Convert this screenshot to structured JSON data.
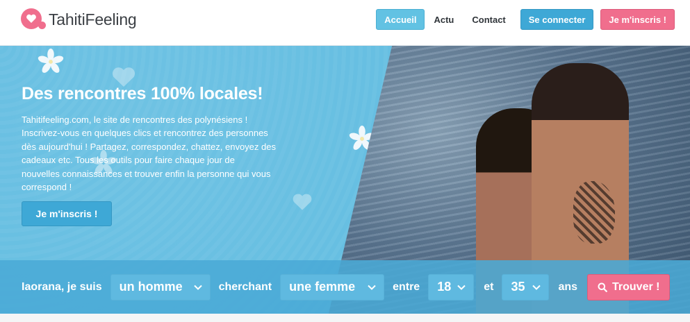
{
  "brand": {
    "name": "TahitiFeeling",
    "colors": {
      "pink": "#f06e8d",
      "blue": "#3ea8d6",
      "light_blue": "#62c2e3",
      "hero_bg": "#67bfe2"
    }
  },
  "nav": {
    "items": [
      {
        "label": "Accueil",
        "style": "active"
      },
      {
        "label": "Actu",
        "style": "link"
      },
      {
        "label": "Contact",
        "style": "link"
      },
      {
        "label": "Se connecter",
        "style": "blue"
      },
      {
        "label": "Je m'inscris !",
        "style": "pink"
      }
    ]
  },
  "hero": {
    "title": "Des rencontres 100% locales!",
    "lines": [
      "Tahitifeeling.com, le site de rencontres des polynésiens !",
      "Inscrivez-vous en quelques clics et rencontrez des personnes",
      "dès aujourd'hui ! Partagez, correspondez, chattez, envoyez des",
      "cadeaux etc. Tous les outils pour faire chaque jour de",
      "nouvelles connaissances et trouver enfin la personne qui vous",
      "correspond !"
    ],
    "cta_label": "Je m'inscris !"
  },
  "search": {
    "intro": "Iaorana, je suis",
    "gender_value": "un homme",
    "seeking_label": "cherchant",
    "seeking_value": "une femme",
    "between_label": "entre",
    "age_min": "18",
    "and_label": "et",
    "age_max": "35",
    "years_label": "ans",
    "submit_label": "Trouver !",
    "icons": [
      "chevron-down-icon",
      "search-icon"
    ]
  }
}
